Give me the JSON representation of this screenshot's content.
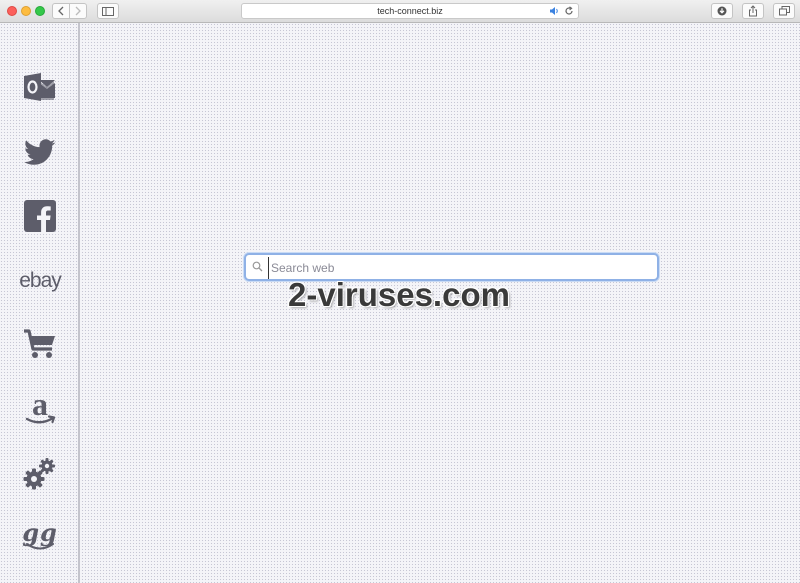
{
  "browser": {
    "url": "tech-connect.biz"
  },
  "sidebar": {
    "items": [
      {
        "name": "outlook",
        "icon": "outlook-icon"
      },
      {
        "name": "twitter",
        "icon": "twitter-icon"
      },
      {
        "name": "facebook",
        "icon": "facebook-icon"
      },
      {
        "name": "ebay",
        "icon": "ebay-logo",
        "label": "ebay"
      },
      {
        "name": "shopping",
        "icon": "shopping-cart-icon"
      },
      {
        "name": "amazon",
        "icon": "amazon-icon"
      },
      {
        "name": "settings",
        "icon": "gears-icon"
      },
      {
        "name": "gg",
        "icon": "gg-logo",
        "label": "gg"
      }
    ],
    "icon_color": "#5d5d6a"
  },
  "search": {
    "placeholder": "Search web",
    "value": ""
  },
  "watermark": {
    "text": "2-viruses.com"
  },
  "colors": {
    "search_border": "#8fb1e6",
    "sidebar_divider": "#c4c4cc"
  }
}
